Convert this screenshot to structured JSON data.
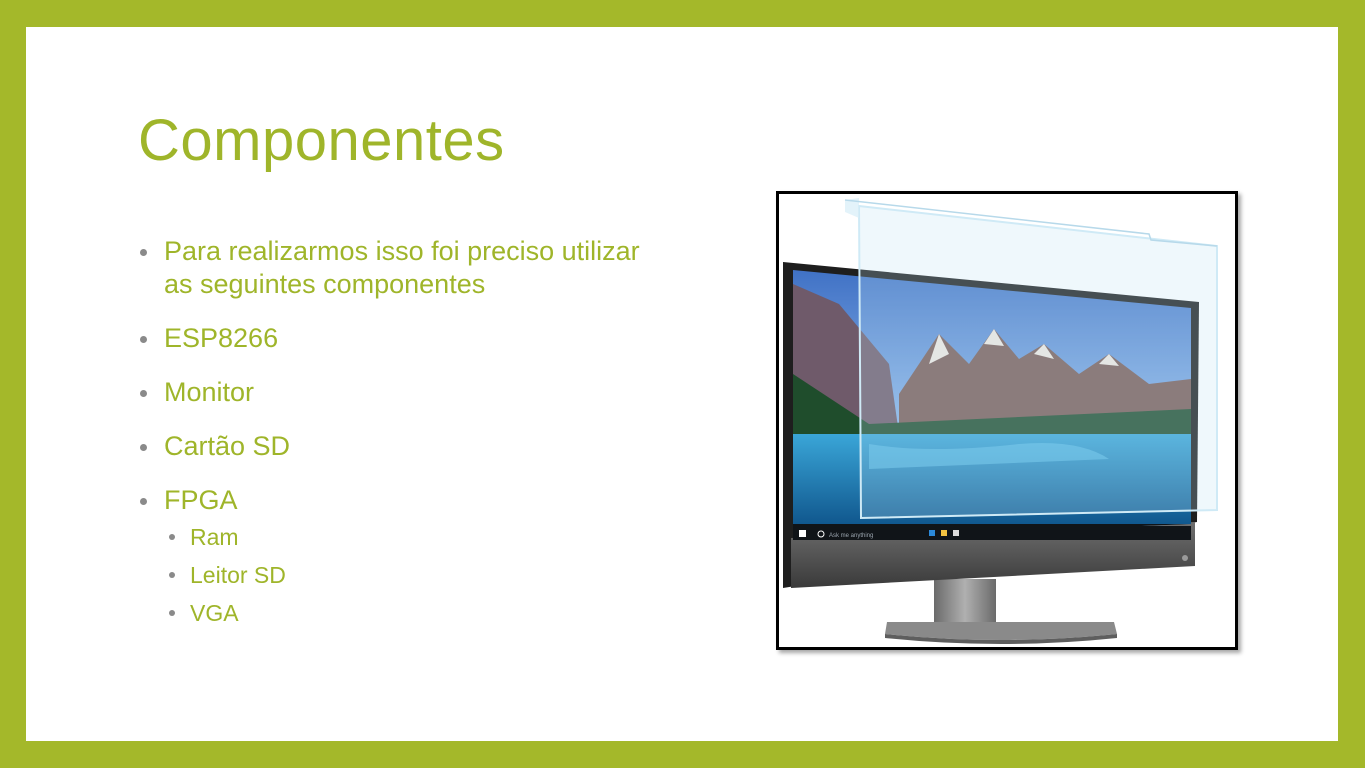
{
  "slide": {
    "title": "Componentes",
    "bullets": [
      {
        "text": "Para realizarmos isso foi preciso utilizar as seguintes componentes"
      },
      {
        "text": "ESP8266"
      },
      {
        "text": "Monitor"
      },
      {
        "text": "Cartão SD"
      },
      {
        "text": "FPGA",
        "sub": [
          "Ram",
          "Leitor SD",
          "VGA"
        ]
      }
    ]
  },
  "picture": {
    "taskbar_search": "Ask me anything"
  },
  "colors": {
    "frame_green": "#a4b82a",
    "text_green": "#9fb52a",
    "bullet_gray": "#8a8a8a"
  }
}
